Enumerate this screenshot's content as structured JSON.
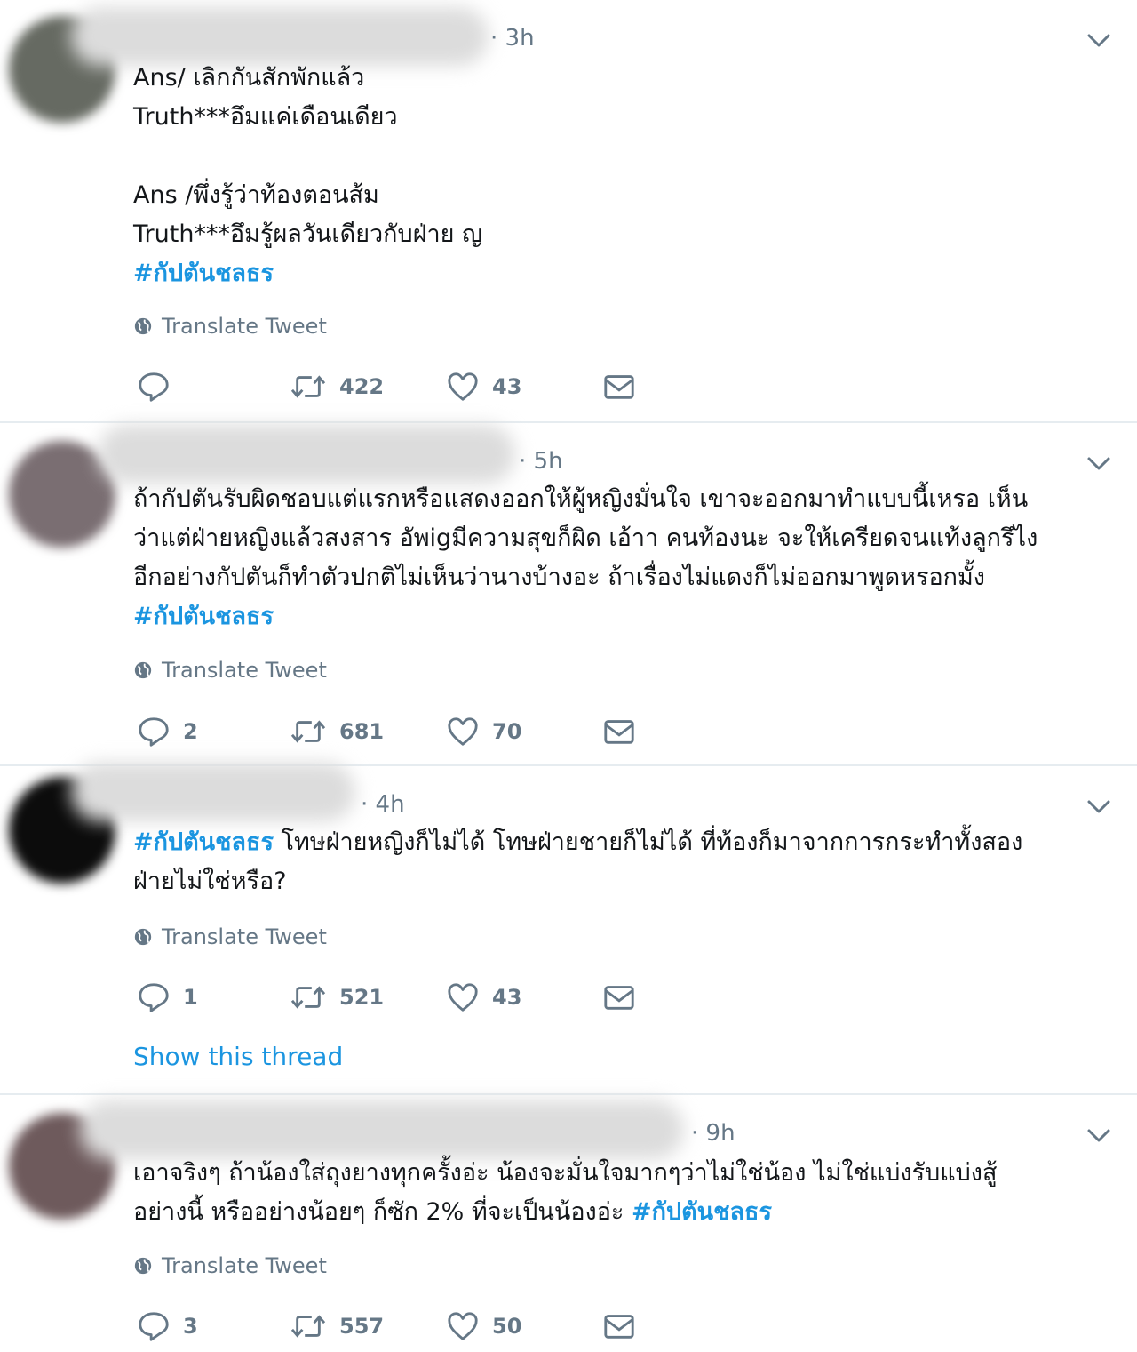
{
  "colors": {
    "link": "#1b95e0",
    "muted": "#657786",
    "divider": "#e6ecf0"
  },
  "tweets": [
    {
      "time": "· 3h",
      "lines": [
        "Ans/ เลิกกันสักพักแล้ว",
        "Truth***อึมแค่เดือนเดียว",
        "",
        "Ans /พึ่งรู้ว่าท้องตอนส้ม",
        "Truth***อึมรู้ผลวันเดียวกับฝ่าย ญ"
      ],
      "hashtag": "#กัปตันชลธร",
      "translate": "Translate Tweet",
      "reply_count": "",
      "retweet_count": "422",
      "like_count": "43"
    },
    {
      "time": "· 5h",
      "lines": [
        "ถ้ากัปตันรับผิดชอบแต่แรกหรือแสดงออกให้ผู้หญิงมั่นใจ เขาจะออกมาทำแบบนี้เหรอ เห็น",
        "ว่าแต่ฝ่ายหญิงแล้วสงสาร อัพigมีความสุขก็ผิด เอ้าา คนท้องนะ จะให้เครียดจนแท้งลูกรึไง",
        "อีกอย่างกัปตันก็ทำตัวปกติไม่เห็นว่านางบ้างอะ ถ้าเรื่องไม่แดงก็ไม่ออกมาพูดหรอกมั้ง"
      ],
      "hashtag": "#กัปตันชลธร",
      "translate": "Translate Tweet",
      "reply_count": "2",
      "retweet_count": "681",
      "like_count": "70"
    },
    {
      "time": "· 4h",
      "hashtag": "#กัปตันชลธร",
      "line1_rest": " โทษฝ่ายหญิงก็ไม่ได้ โทษฝ่ายชายก็ไม่ได้ ที่ท้องก็มาจากการกระทำทั้งสอง",
      "line2": "ฝ่ายไม่ใช่หรือ?",
      "translate": "Translate Tweet",
      "reply_count": "1",
      "retweet_count": "521",
      "like_count": "43",
      "show_thread": "Show this thread"
    },
    {
      "time": "· 9h",
      "line1": "เอาจริงๆ ถ้าน้องใส่ถุงยางทุกครั้งอ่ะ น้องจะมั่นใจมากๆว่าไม่ใช่น้อง ไม่ใช่แบ่งรับแบ่งสู้",
      "line2_start": "อย่างนี้ หรืออย่างน้อยๆ ก็ซัก 2% ที่จะเป็นน้องอ่ะ ",
      "hashtag": "#กัปตันชลธร",
      "translate": "Translate Tweet",
      "reply_count": "3",
      "retweet_count": "557",
      "like_count": "50"
    }
  ]
}
